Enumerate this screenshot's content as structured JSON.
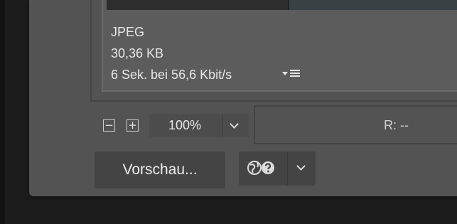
{
  "preview_info": {
    "format": "JPEG",
    "file_size": "30,36 KB",
    "download_time": "6 Sek. bei 56,6 Kbit/s"
  },
  "icons": {
    "download_speed_menu": "download-speed-menu-icon",
    "zoom_out": "zoom-out-icon",
    "zoom_in": "zoom-in-icon",
    "zoom_dropdown": "chevron-down-icon",
    "browser_help": "browser-help-icon",
    "browser_dropdown": "chevron-down-icon"
  },
  "zoom": {
    "out_symbol": "−",
    "in_symbol": "+",
    "value": "100%"
  },
  "readout": {
    "r_value": "R: --"
  },
  "buttons": {
    "preview_label": "Vorschau..."
  },
  "colors": {
    "dialog_background": "#535353",
    "control_background": "#444444",
    "text": "#e6e6e6"
  }
}
